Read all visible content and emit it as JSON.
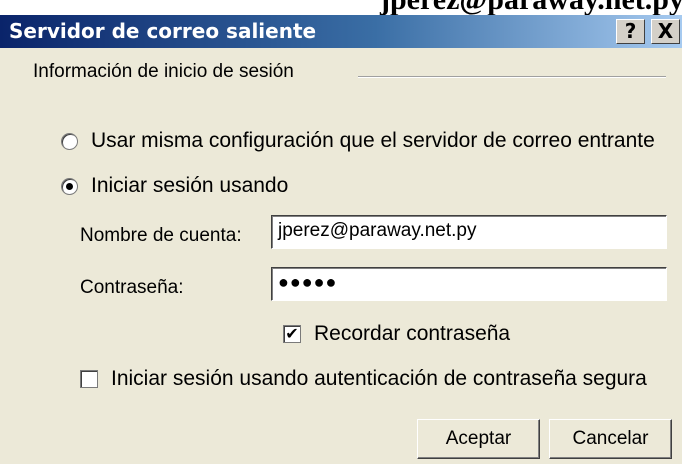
{
  "banner_text": "jperez@paraway.net.py,",
  "window": {
    "title": "Servidor de correo saliente",
    "help_label": "?",
    "close_label": "X"
  },
  "login_group": {
    "title": "Información de inicio de sesión",
    "options": [
      {
        "label": "Usar misma configuración que el servidor de correo entrante",
        "selected": false
      },
      {
        "label": "Iniciar sesión usando",
        "selected": true
      }
    ],
    "account_label": "Nombre de cuenta:",
    "account_value": "jperez@paraway.net.py",
    "password_label": "Contraseña:",
    "password_value": "●●●●●",
    "remember_label": "Recordar contraseña",
    "remember_checked": true,
    "remember_mark": "✔",
    "spa_label": "Iniciar sesión usando autenticación de contraseña segura",
    "spa_checked": false
  },
  "buttons": {
    "ok": "Aceptar",
    "cancel": "Cancelar"
  }
}
